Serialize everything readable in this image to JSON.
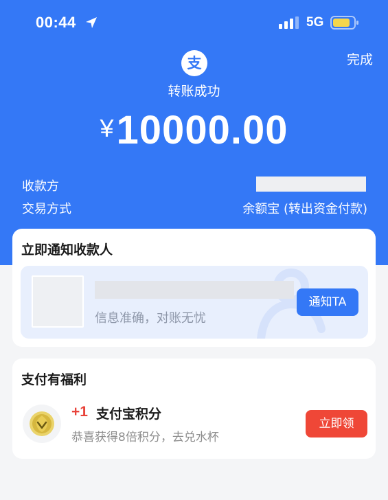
{
  "status_bar": {
    "time": "00:44",
    "network": "5G"
  },
  "header": {
    "done_label": "完成",
    "success_title": "转账成功",
    "currency": "¥",
    "amount": "10000.00"
  },
  "details": {
    "payee_label": "收款方",
    "method_label": "交易方式",
    "method_value": "余额宝 (转出资金付款)"
  },
  "notify_card": {
    "title": "立即通知收款人",
    "subtitle": "信息准确，对账无忧",
    "button_label": "通知TA"
  },
  "benefit_card": {
    "title": "支付有福利",
    "points_plus": "+1",
    "points_name": "支付宝积分",
    "points_sub": "恭喜获得8倍积分，去兑水杯",
    "button_label": "立即领"
  },
  "colors": {
    "brand_blue": "#3478f6",
    "battery_yellow": "#f5d64b",
    "claim_red": "#ef4737",
    "plus_red": "#e8433a"
  },
  "icons": {
    "location": "location-arrow-icon",
    "signal": "signal-bars-icon",
    "battery": "battery-icon",
    "app_logo": "alipay-logo-icon",
    "coin": "points-coin-icon"
  }
}
